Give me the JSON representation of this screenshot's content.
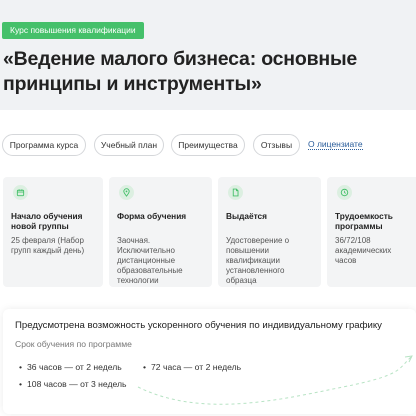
{
  "hero": {
    "badge": "Курс повышения квалификации",
    "title": "«Ведение малого бизнеса: основные принципы и инструменты»"
  },
  "tabs": {
    "items": [
      {
        "label": "Программа курса"
      },
      {
        "label": "Учебный план"
      },
      {
        "label": "Преимущества"
      },
      {
        "label": "Отзывы"
      }
    ],
    "license_link": "О лицензиате"
  },
  "cards": [
    {
      "icon": "calendar-icon",
      "title": "Начало обучения новой группы",
      "text": "25 февраля (Набор групп каждый день)"
    },
    {
      "icon": "location-pin-icon",
      "title": "Форма обучения",
      "text": "Заочная. Исключительно дистанционные образовательные технологии"
    },
    {
      "icon": "document-icon",
      "title": "Выдаётся",
      "text": "Удостоверение о повышении квалификации установленного образца"
    },
    {
      "icon": "clock-icon",
      "title": "Трудоемкость программы",
      "text": "36/72/108 академических часов"
    }
  ],
  "accelerated": {
    "title": "Предусмотрена возможность ускоренного обучения по индивидуальному графику",
    "subtitle": "Срок обучения по программе",
    "options": [
      "36 часов — от 2 недель",
      "72 часа — от 2 недель",
      "108 часов — от 3 недель"
    ]
  },
  "colors": {
    "accent": "#45c06a",
    "link": "#2a5d9b",
    "hero_bg": "#f0f2f4",
    "card_bg": "#f3f4f5"
  }
}
